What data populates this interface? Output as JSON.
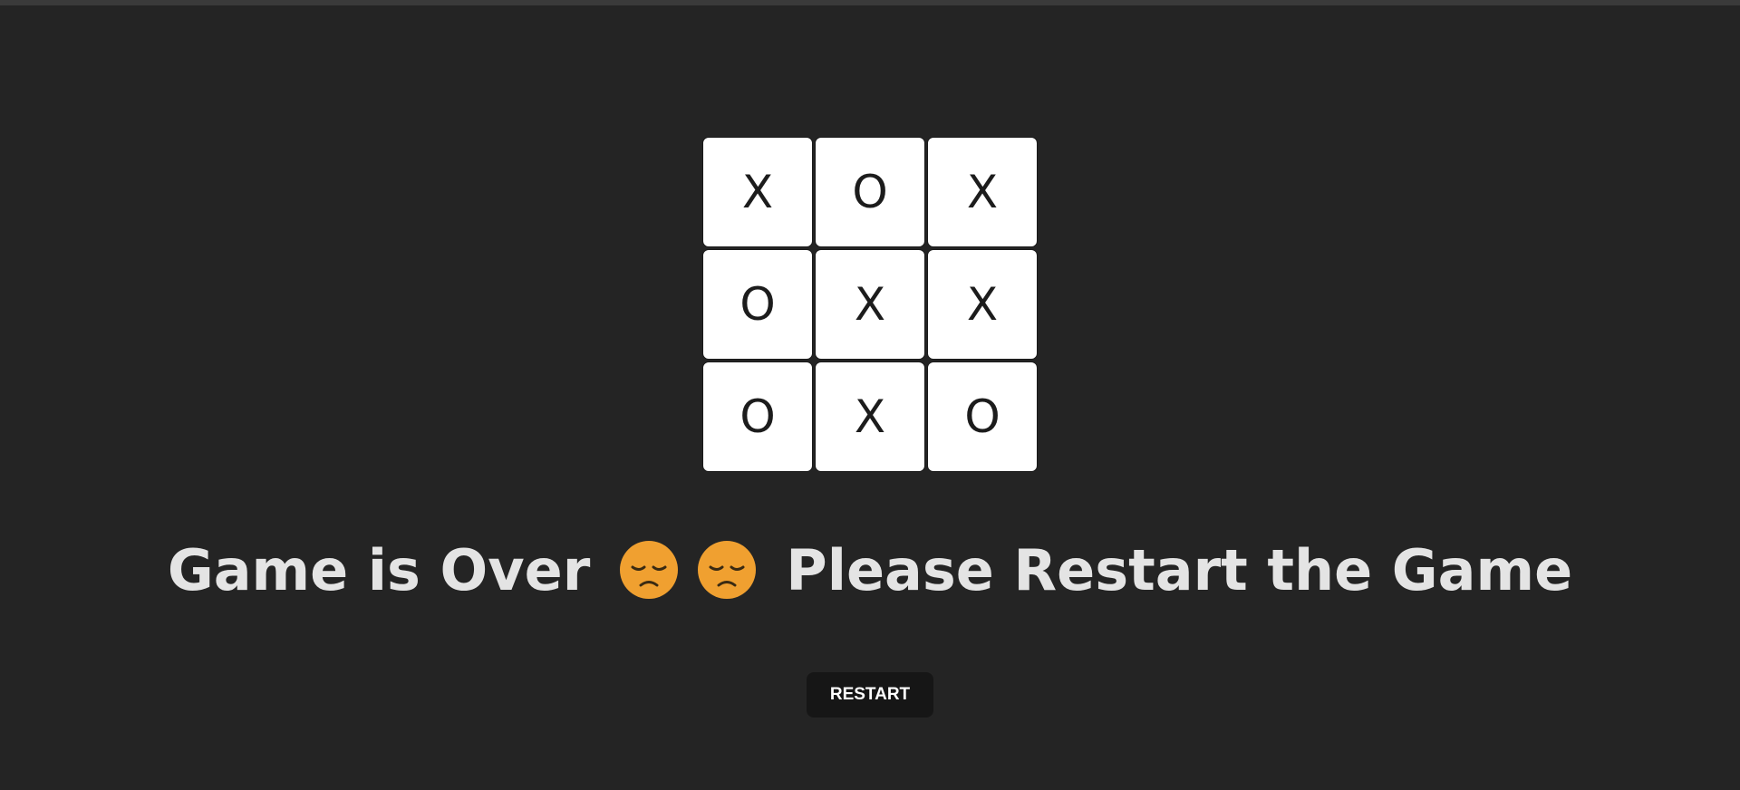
{
  "board": {
    "cells": [
      "X",
      "O",
      "X",
      "O",
      "X",
      "X",
      "O",
      "X",
      "O"
    ]
  },
  "status": {
    "prefix": "Game is Over",
    "emoji_icon": "pensive-face-icon",
    "emoji_count": 2,
    "suffix": "Please Restart the Game"
  },
  "restart_button": {
    "label": "RESTART"
  },
  "colors": {
    "background": "#242424",
    "cell": "#ffffff",
    "text": "#e4e4e4",
    "emoji": "#f0a030",
    "button": "#161616"
  }
}
